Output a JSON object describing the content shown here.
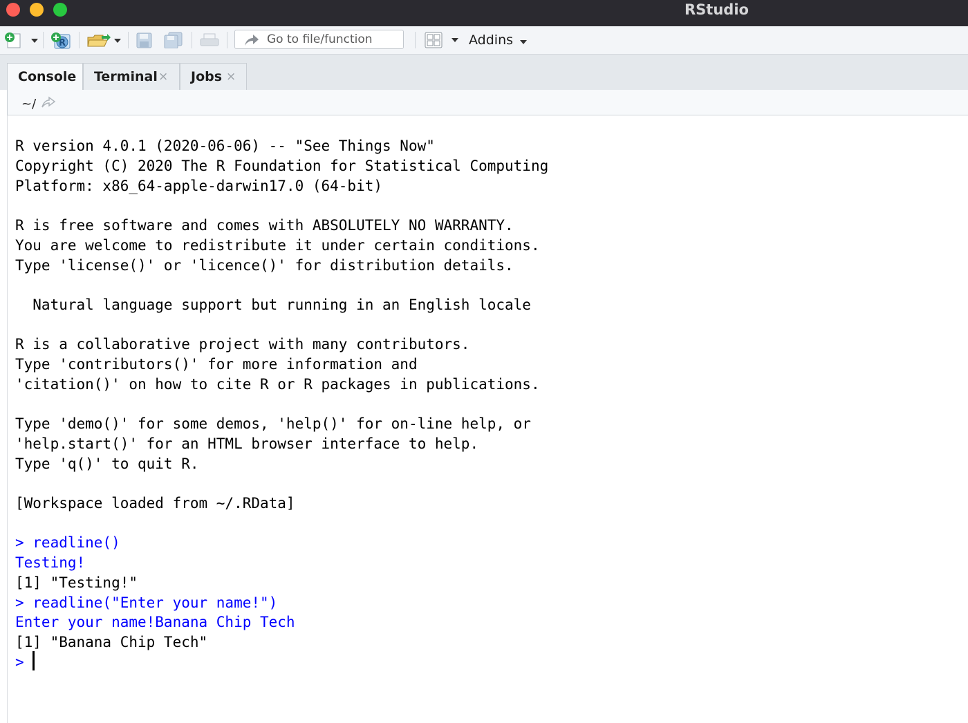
{
  "window": {
    "title": "RStudio"
  },
  "toolbar": {
    "goto_placeholder": "Go to file/function",
    "addins_label": "Addins"
  },
  "tabs": [
    {
      "label": "Console",
      "active": true
    },
    {
      "label": "Terminal",
      "close": "×"
    },
    {
      "label": "Jobs",
      "close": "×"
    }
  ],
  "console": {
    "path": "~/",
    "lines": [
      "R version 4.0.1 (2020-06-06) -- \"See Things Now\"",
      "Copyright (C) 2020 The R Foundation for Statistical Computing",
      "Platform: x86_64-apple-darwin17.0 (64-bit)",
      "R is free software and comes with ABSOLUTELY NO WARRANTY.",
      "You are welcome to redistribute it under certain conditions.",
      "Type 'license()' or 'licence()' for distribution details.",
      "  Natural language support but running in an English locale",
      "R is a collaborative project with many contributors.",
      "Type 'contributors()' for more information and",
      "'citation()' on how to cite R or R packages in publications.",
      "Type 'demo()' for some demos, 'help()' for on-line help, or",
      "'help.start()' for an HTML browser interface to help.",
      "Type 'q()' to quit R.",
      "[Workspace loaded from ~/.RData]",
      "> readline()",
      "Testing!",
      "[1] \"Testing!\"",
      "> readline(\"Enter your name!\")",
      "Enter your name!Banana Chip Tech",
      "[1] \"Banana Chip Tech\"",
      ">"
    ]
  },
  "colors": {
    "input": "#0000ff",
    "output": "#000000",
    "titlebar": "#2b2a30"
  }
}
